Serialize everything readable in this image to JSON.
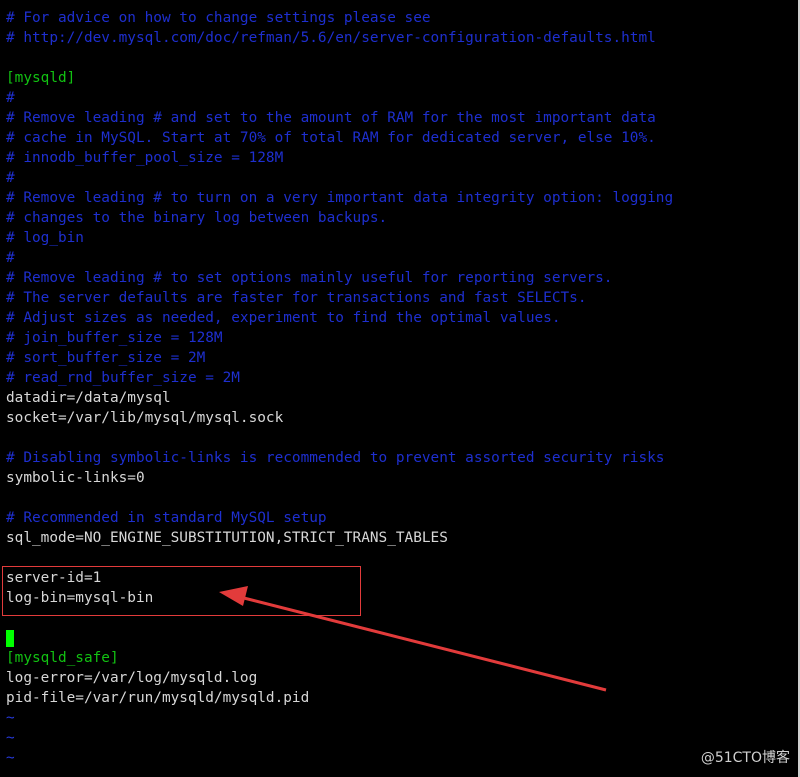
{
  "terminal": {
    "lines": [
      {
        "type": "comment",
        "text": "# For advice on how to change settings please see"
      },
      {
        "type": "comment",
        "text": "# http://dev.mysql.com/doc/refman/5.6/en/server-configuration-defaults.html"
      },
      {
        "type": "blank",
        "text": ""
      },
      {
        "type": "section",
        "text": "[mysqld]"
      },
      {
        "type": "comment",
        "text": "#"
      },
      {
        "type": "comment",
        "text": "# Remove leading # and set to the amount of RAM for the most important data"
      },
      {
        "type": "comment",
        "text": "# cache in MySQL. Start at 70% of total RAM for dedicated server, else 10%."
      },
      {
        "type": "comment",
        "text": "# innodb_buffer_pool_size = 128M"
      },
      {
        "type": "comment",
        "text": "#"
      },
      {
        "type": "comment",
        "text": "# Remove leading # to turn on a very important data integrity option: logging"
      },
      {
        "type": "comment",
        "text": "# changes to the binary log between backups."
      },
      {
        "type": "comment",
        "text": "# log_bin"
      },
      {
        "type": "comment",
        "text": "#"
      },
      {
        "type": "comment",
        "text": "# Remove leading # to set options mainly useful for reporting servers."
      },
      {
        "type": "comment",
        "text": "# The server defaults are faster for transactions and fast SELECTs."
      },
      {
        "type": "comment",
        "text": "# Adjust sizes as needed, experiment to find the optimal values."
      },
      {
        "type": "comment",
        "text": "# join_buffer_size = 128M"
      },
      {
        "type": "comment",
        "text": "# sort_buffer_size = 2M"
      },
      {
        "type": "comment",
        "text": "# read_rnd_buffer_size = 2M"
      },
      {
        "type": "plain",
        "text": "datadir=/data/mysql"
      },
      {
        "type": "plain",
        "text": "socket=/var/lib/mysql/mysql.sock"
      },
      {
        "type": "blank",
        "text": ""
      },
      {
        "type": "comment",
        "text": "# Disabling symbolic-links is recommended to prevent assorted security risks"
      },
      {
        "type": "plain",
        "text": "symbolic-links=0"
      },
      {
        "type": "blank",
        "text": ""
      },
      {
        "type": "comment",
        "text": "# Recommended in standard MySQL setup"
      },
      {
        "type": "plain",
        "text": "sql_mode=NO_ENGINE_SUBSTITUTION,STRICT_TRANS_TABLES"
      },
      {
        "type": "blank",
        "text": ""
      },
      {
        "type": "plain",
        "text": "server-id=1"
      },
      {
        "type": "plain",
        "text": "log-bin=mysql-bin"
      },
      {
        "type": "blank",
        "text": ""
      },
      {
        "type": "cursor",
        "text": ""
      },
      {
        "type": "section",
        "text": "[mysqld_safe]"
      },
      {
        "type": "plain",
        "text": "log-error=/var/log/mysqld.log"
      },
      {
        "type": "plain",
        "text": "pid-file=/var/run/mysqld/mysqld.pid"
      },
      {
        "type": "tilde",
        "text": "~"
      },
      {
        "type": "tilde",
        "text": "~"
      },
      {
        "type": "tilde",
        "text": "~"
      }
    ]
  },
  "colors": {
    "background": "#000000",
    "comment": "#1e2fcf",
    "plain": "#d7d7d7",
    "section": "#12c212",
    "cursor": "#00ff00",
    "annotation": "#e23b3b"
  },
  "watermark": {
    "text": "@51CTO博客"
  }
}
